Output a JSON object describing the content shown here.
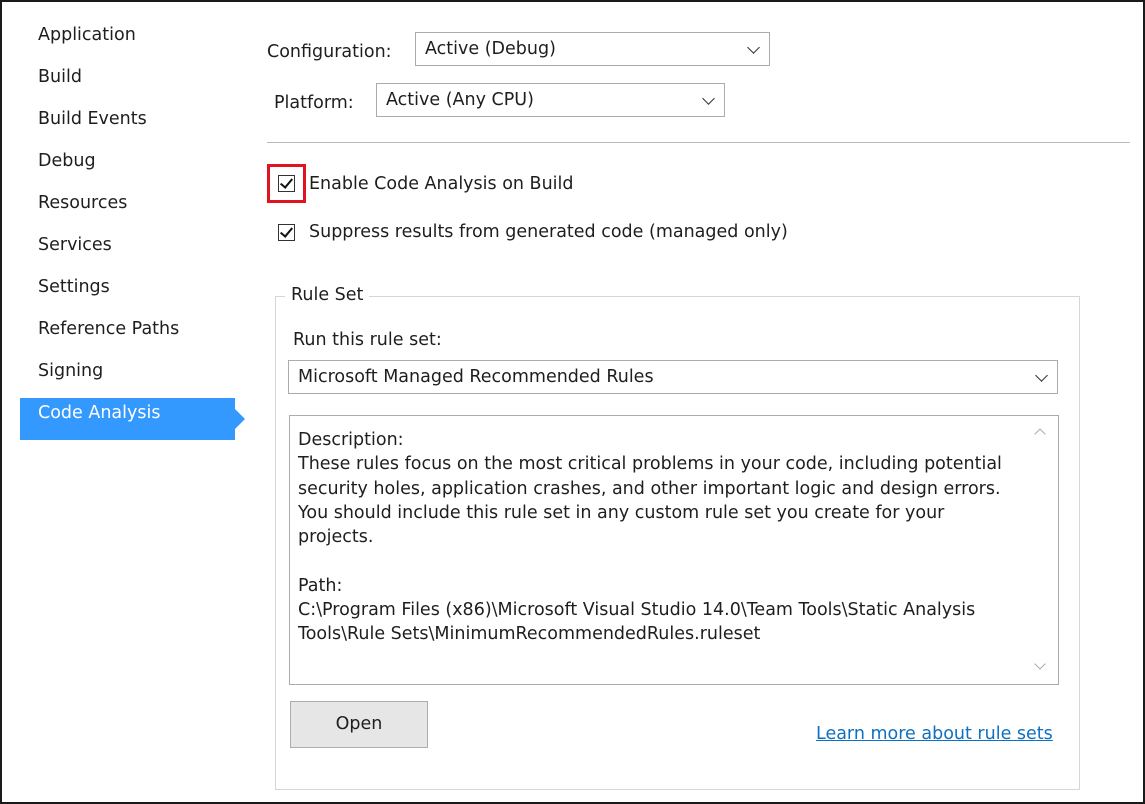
{
  "sidebar": {
    "items": [
      {
        "label": "Application"
      },
      {
        "label": "Build"
      },
      {
        "label": "Build Events"
      },
      {
        "label": "Debug"
      },
      {
        "label": "Resources"
      },
      {
        "label": "Services"
      },
      {
        "label": "Settings"
      },
      {
        "label": "Reference Paths"
      },
      {
        "label": "Signing"
      },
      {
        "label": "Code Analysis",
        "selected": true
      }
    ]
  },
  "config": {
    "configuration_label": "Configuration:",
    "configuration_value": "Active (Debug)",
    "platform_label": "Platform:",
    "platform_value": "Active (Any CPU)"
  },
  "options": {
    "enable_code_analysis": {
      "label": "Enable Code Analysis on Build",
      "checked": true
    },
    "suppress_generated": {
      "label": "Suppress results from generated code (managed only)",
      "checked": true
    }
  },
  "ruleset": {
    "group_title": "Rule Set",
    "run_label": "Run this rule set:",
    "selected_rule_set": "Microsoft Managed Recommended Rules",
    "description": "Description:\nThese rules focus on the most critical problems in your code, including potential security holes, application crashes, and other important logic and design errors. You should include this rule set in any custom rule set you create for your projects.\n\nPath:\nC:\\Program Files (x86)\\Microsoft Visual Studio 14.0\\Team Tools\\Static Analysis Tools\\Rule Sets\\MinimumRecommendedRules.ruleset",
    "open_button": "Open",
    "learn_more_link": "Learn more about rule sets"
  },
  "colors": {
    "selection": "#3399ff",
    "highlight_box": "#e0141e",
    "link": "#0e70c0"
  }
}
